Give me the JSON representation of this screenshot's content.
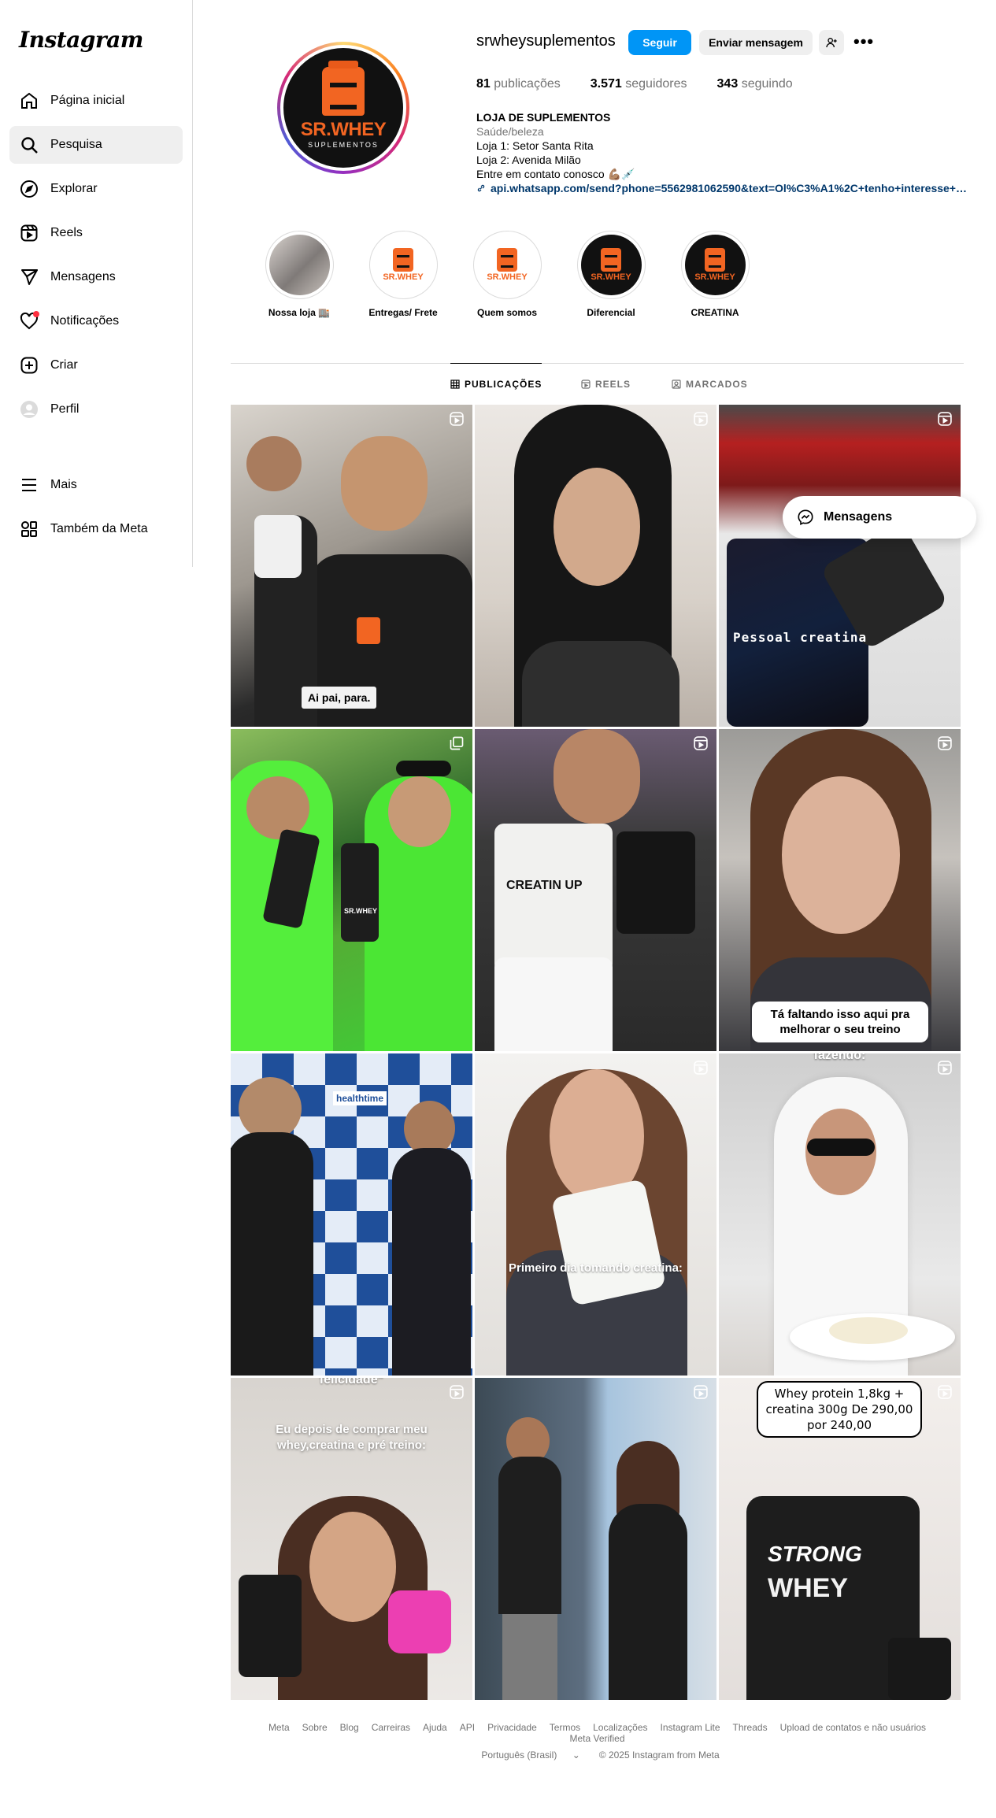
{
  "app": {
    "logo": "Instagram"
  },
  "sidebar": {
    "items": [
      {
        "label": "Página inicial",
        "icon": "home-icon"
      },
      {
        "label": "Pesquisa",
        "icon": "search-icon"
      },
      {
        "label": "Explorar",
        "icon": "compass-icon"
      },
      {
        "label": "Reels",
        "icon": "reels-icon"
      },
      {
        "label": "Mensagens",
        "icon": "direct-icon"
      },
      {
        "label": "Notificações",
        "icon": "heart-icon"
      },
      {
        "label": "Criar",
        "icon": "plus-square-icon"
      },
      {
        "label": "Perfil",
        "icon": "avatar-icon"
      },
      {
        "label": "Mais",
        "icon": "menu-icon"
      },
      {
        "label": "Também da Meta",
        "icon": "meta-apps-icon"
      }
    ],
    "active": "Pesquisa"
  },
  "profile": {
    "username": "srwheysuplementos",
    "follow_label": "Seguir",
    "message_label": "Enviar mensagem",
    "avatar_brand": "SR.WHEY",
    "avatar_sub": "SUPLEMENTOS",
    "stats": {
      "posts_count": "81",
      "posts_label": "publicações",
      "followers_count": "3.571",
      "followers_label": "seguidores",
      "following_count": "343",
      "following_label": "seguindo"
    },
    "bio": {
      "name": "LOJA DE SUPLEMENTOS",
      "category": "Saúde/beleza",
      "line1": "Loja 1: Setor Santa Rita",
      "line2": "Loja 2: Avenida Milão",
      "line3": "Entre em contato conosco 💪🏽💉",
      "link": "api.whatsapp.com/send?phone=5562981062590&text=Ol%C3%A1%2C+tenho+interesse+no..."
    }
  },
  "highlights": [
    {
      "label": "Nossa loja 🏬"
    },
    {
      "label": "Entregas/ Frete"
    },
    {
      "label": "Quem somos"
    },
    {
      "label": "Diferencial"
    },
    {
      "label": "CREATINA"
    }
  ],
  "highlight_mini_text": "SR.WHEY",
  "tabs": [
    {
      "label": "PUBLICAÇÕES",
      "active": true
    },
    {
      "label": "REELS",
      "active": false
    },
    {
      "label": "MARCADOS",
      "active": false
    }
  ],
  "posts": {
    "p1_caption": "Ai pai, para.",
    "p3_caption": "Pessoal creatina",
    "p4_shirt": "SR.WHEY",
    "p5_label": "CREATIN UP",
    "p6_caption": "Tá faltando isso aqui pra melhorar o seu treino",
    "p7_banner": "healthtime",
    "p8_caption": "Primeiro dia tomando creatina:",
    "p9_caption": "fazendo:",
    "p10_caption_top": "felicidade\"",
    "p10_caption": "Eu depois de comprar meu whey,creatina e pré treino:",
    "p12_bubble": "Whey protein 1,8kg + creatina 300g De 290,00 por 240,00",
    "p12_brand": "STRONG",
    "p12_product": "WHEY"
  },
  "floating_messages": {
    "label": "Mensagens"
  },
  "footer": {
    "links": [
      "Meta",
      "Sobre",
      "Blog",
      "Carreiras",
      "Ajuda",
      "API",
      "Privacidade",
      "Termos",
      "Localizações",
      "Instagram Lite",
      "Threads",
      "Upload de contatos e não usuários",
      "Meta Verified"
    ],
    "language": "Português (Brasil)",
    "copyright": "© 2025 Instagram from Meta"
  }
}
